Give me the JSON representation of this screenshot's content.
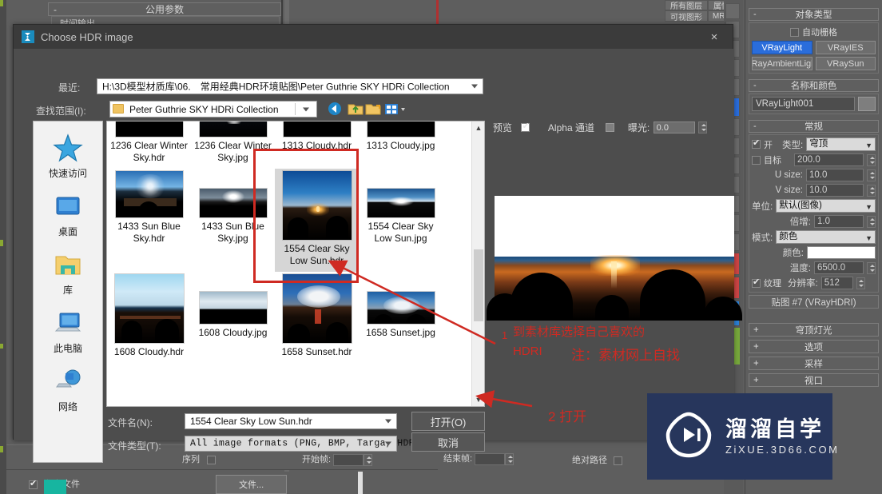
{
  "app": {
    "background_panels": {
      "common_params": "公用参数",
      "time_output": "时间输出",
      "toolbar_cells": [
        "所有图层",
        "属性",
        "可视图形",
        "MRS"
      ],
      "sequence_label": "序列",
      "start_frame_label": "开始帧:",
      "end_frame_label": "结束帧:",
      "absolute_path_label": "绝对路径",
      "save_file_label": "保存文件",
      "file_button": "文件..."
    },
    "command_panel": {
      "object_type": {
        "title": "对象类型",
        "auto_grid": "自动栅格",
        "buttons": [
          "VRayLight",
          "VRayIES",
          "VRayAmbientLight",
          "VRaySun"
        ],
        "selected": "VRayLight"
      },
      "name_and_color": {
        "title": "名称和颜色",
        "name_value": "VRayLight001"
      },
      "general": {
        "title": "常规",
        "on_label": "开",
        "type_label": "类型:",
        "type_value": "穹顶",
        "target_label": "目标",
        "target_value": "200.0",
        "u_size_label": "U size:",
        "u_size_value": "10.0",
        "v_size_label": "V size:",
        "v_size_value": "10.0",
        "units_label": "单位:",
        "units_value": "默认(图像)",
        "multiplier_label": "倍增:",
        "multiplier_value": "1.0",
        "mode_label": "模式:",
        "mode_value": "颜色",
        "color_label": "颜色:",
        "temperature_label": "温度:",
        "temperature_value": "6500.0",
        "texture_label": "纹理",
        "resolution_label": "分辨率:",
        "resolution_value": "512",
        "map_button": "贴图 #7 (VRayHDRI)"
      },
      "collapsed_rollouts": [
        "穹顶灯光",
        "选项",
        "采样",
        "视口"
      ]
    }
  },
  "dialog": {
    "title": "Choose HDR image",
    "close_icon": "×",
    "recent_label": "最近:",
    "recent_value": "H:\\3D模型材质库\\06.　常用经典HDR环境贴图\\Peter Guthrie SKY HDRi Collection",
    "look_in_label": "查找范围(I):",
    "look_in_value": "Peter Guthrie SKY HDRi Collection",
    "nav_icons": [
      "back-icon",
      "up-folder-icon",
      "new-folder-icon",
      "view-mode-icon"
    ],
    "places": [
      {
        "name": "快速访问",
        "icon": "star-icon"
      },
      {
        "name": "桌面",
        "icon": "desktop-icon"
      },
      {
        "name": "库",
        "icon": "library-folder-icon"
      },
      {
        "name": "此电脑",
        "icon": "this-pc-icon"
      },
      {
        "name": "网络",
        "icon": "network-icon"
      }
    ],
    "files": [
      {
        "name": "1236 Clear Winter Sky.hdr",
        "thumb": "dark-dusk",
        "selected": false
      },
      {
        "name": "1236 Clear Winter Sky.jpg",
        "thumb": "blue-sunrise",
        "selected": false
      },
      {
        "name": "1313 Cloudy.hdr",
        "thumb": "dark-dusk2",
        "selected": false
      },
      {
        "name": "1313 Cloudy.jpg",
        "thumb": "grey-cloud",
        "selected": false
      },
      {
        "name": "1433 Sun Blue Sky.hdr",
        "thumb": "blue-sun-halo",
        "selected": false
      },
      {
        "name": "1433 Sun Blue Sky.jpg",
        "thumb": "bright-sun-haze",
        "selected": false
      },
      {
        "name": "1554 Clear Sky Low Sun.hdr",
        "thumb": "clear-low-sun",
        "selected": true
      },
      {
        "name": "1554 Clear Sky Low Sun.jpg",
        "thumb": "clear-low-sun2",
        "selected": false
      },
      {
        "name": "1608 Cloudy.hdr",
        "thumb": "pale-clouds",
        "selected": false
      },
      {
        "name": "1608 Cloudy.jpg",
        "thumb": "pale-clouds2",
        "selected": false
      },
      {
        "name": "1658 Sunset.hdr",
        "thumb": "cumulus-blue",
        "selected": false
      },
      {
        "name": "1658 Sunset.jpg",
        "thumb": "cumulus-blue2",
        "selected": false
      }
    ],
    "preview": {
      "preview_label": "预览",
      "preview_checked": true,
      "alpha_label": "Alpha 通道",
      "alpha_checked": false,
      "exposure_label": "曝光:",
      "exposure_value": "0.0"
    },
    "file_name_label": "文件名(N):",
    "file_name_value": "1554 Clear Sky Low Sun.hdr",
    "file_type_label": "文件类型(T):",
    "file_type_value": "All image formats (PNG, BMP, Targa, HDR,",
    "open_button": "打开(O)",
    "cancel_button": "取消"
  },
  "annotations": {
    "step1_number": "1",
    "step1_line1": "到素材库选择自己喜欢的",
    "step1_line2": "HDRI",
    "step1_note": "注：素材网上自找",
    "step2": "2 打开",
    "red": "#cf2a22"
  },
  "watermark": {
    "cn": "溜溜自学",
    "en": "ZiXUE.3D66.COM",
    "bg": "#27365c"
  }
}
